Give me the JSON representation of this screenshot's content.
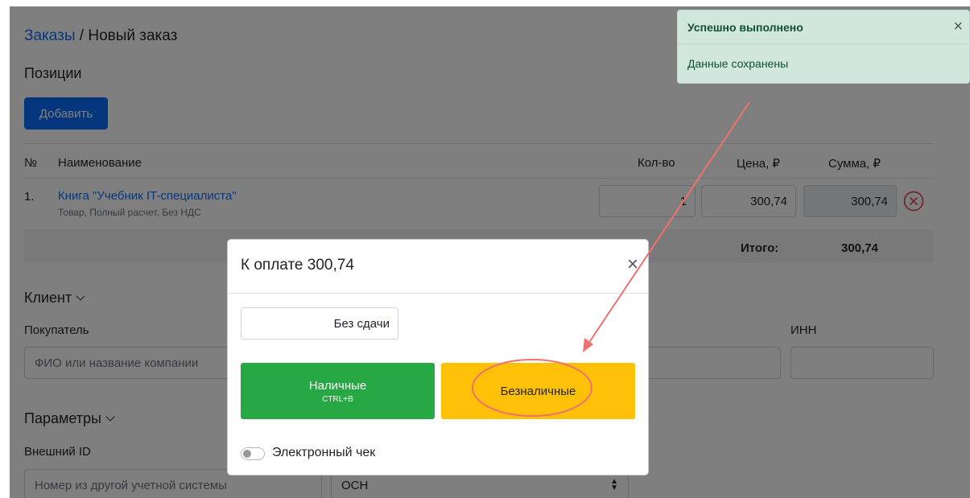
{
  "breadcrumb": {
    "parent": "Заказы",
    "separator": "/",
    "current": "Новый заказ"
  },
  "positions": {
    "heading": "Позиции",
    "add_button": "Добавить",
    "columns": {
      "num": "№",
      "name": "Наименование",
      "qty": "Кол-во",
      "price": "Цена, ₽",
      "sum": "Сумма, ₽"
    },
    "rows": [
      {
        "num": "1.",
        "name": "Книга \"Учебник IT-специалиста\"",
        "desc": "Товар, Полный расчет, Без НДС",
        "qty": "1",
        "price": "300,74",
        "sum": "300,74"
      }
    ],
    "total_label": "Итого:",
    "total_value": "300,74"
  },
  "client": {
    "heading": "Клиент",
    "buyer_label": "Покупатель",
    "buyer_placeholder": "ФИО или название компании",
    "inn_label": "ИНН"
  },
  "params": {
    "heading": "Параметры",
    "external_id_label": "Внешний ID",
    "external_id_placeholder": "Номер из другой учетной системы",
    "tax_value": "ОСН"
  },
  "toast": {
    "title": "Успешно выполнено",
    "message": "Данные сохранены",
    "close": "×",
    "colors": {
      "bg": "#d1e7dd",
      "text": "#0f5132"
    }
  },
  "modal": {
    "title": "К оплате 300,74",
    "close": "×",
    "change_value": "Без сдачи",
    "cash_label": "Наличные",
    "cash_shortcut": "CTRL+B",
    "card_label": "Безналичные",
    "receipt_label": "Электронный чек",
    "colors": {
      "cash": "#28a745",
      "card": "#ffc107",
      "annotation": "#f07070"
    }
  }
}
